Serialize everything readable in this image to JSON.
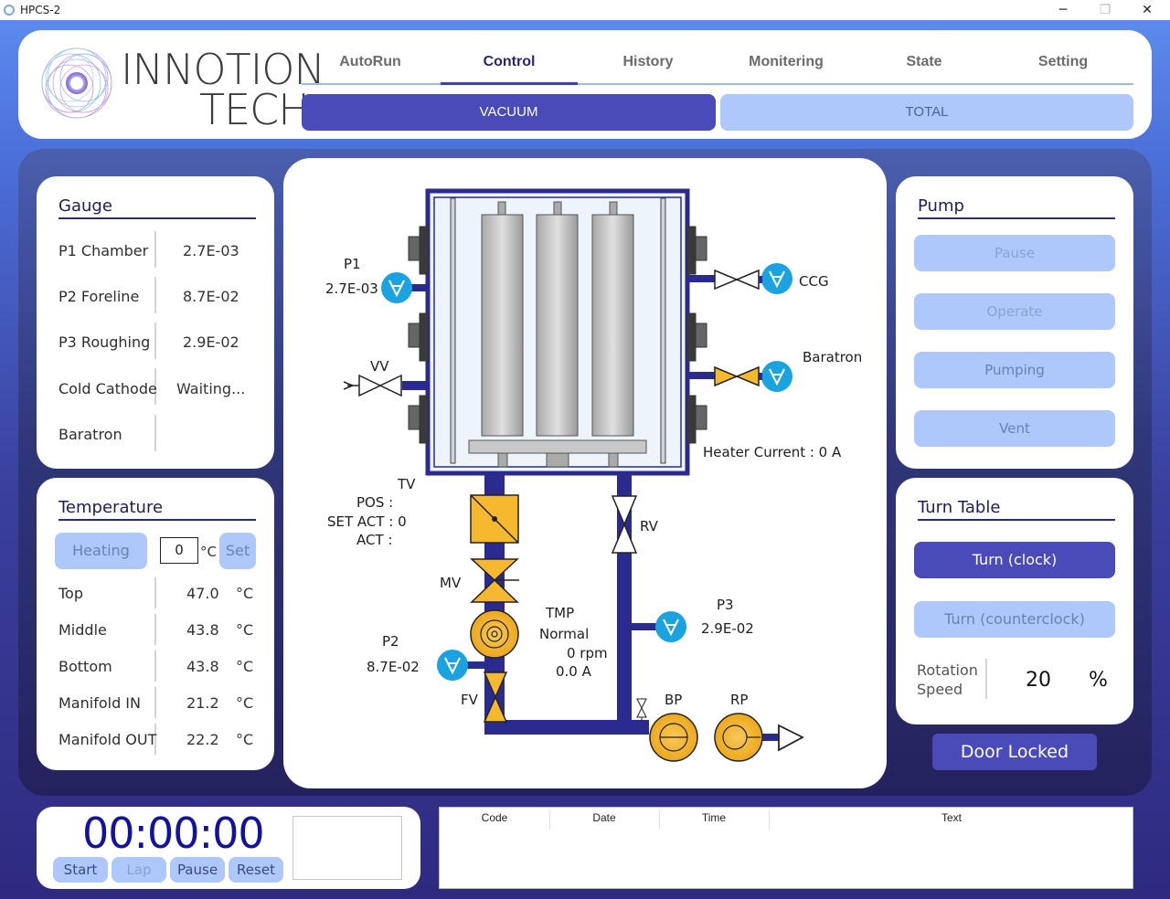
{
  "window": {
    "title": "HPCS-2",
    "minimize_glyph": "─",
    "maximize_glyph": "❐",
    "close_glyph": "✕"
  },
  "logo": {
    "line1": "INNOTION",
    "line2": "TECH"
  },
  "tabs": [
    {
      "label": "AutoRun"
    },
    {
      "label": "Control"
    },
    {
      "label": "History"
    },
    {
      "label": "Monitering"
    },
    {
      "label": "State"
    },
    {
      "label": "Setting"
    }
  ],
  "active_tab": "Control",
  "subtabs": {
    "vacuum": "VACUUM",
    "total": "TOTAL"
  },
  "gauge": {
    "title": "Gauge",
    "rows": [
      {
        "label": "P1 Chamber",
        "value": "2.7E-03"
      },
      {
        "label": "P2 Foreline",
        "value": "8.7E-02"
      },
      {
        "label": "P3 Roughing",
        "value": "2.9E-02"
      },
      {
        "label": "Cold Cathode",
        "value": "Waiting..."
      },
      {
        "label": "Baratron",
        "value": ""
      }
    ]
  },
  "temperature": {
    "title": "Temperature",
    "heating_label": "Heating",
    "setpoint_value": "0",
    "setpoint_unit": "°C",
    "set_label": "Set",
    "rows": [
      {
        "label": "Top",
        "value": "47.0",
        "unit": "°C"
      },
      {
        "label": "Middle",
        "value": "43.8",
        "unit": "°C"
      },
      {
        "label": "Bottom",
        "value": "43.8",
        "unit": "°C"
      },
      {
        "label": "Manifold IN",
        "value": "21.2",
        "unit": "°C"
      },
      {
        "label": "Manifold OUT",
        "value": "22.2",
        "unit": "°C"
      }
    ]
  },
  "diagram": {
    "p1_label": "P1",
    "p1_value": "2.7E-03",
    "ccg_label": "CCG",
    "vv_label": "VV",
    "baratron_label": "Baratron",
    "heater_current_text": "Heater Current :  0 A",
    "tv_label": "TV",
    "pos_text": "POS :",
    "set_act_text": "SET ACT : 0",
    "act_text": "ACT :",
    "rv_label": "RV",
    "mv_label": "MV",
    "tmp_label": "TMP",
    "tmp_status": "Normal",
    "tmp_rpm": "0 rpm",
    "tmp_current": "0.0 A",
    "p3_label": "P3",
    "p3_value": "2.9E-02",
    "p2_label": "P2",
    "p2_value": "8.7E-02",
    "fv_label": "FV",
    "bp_label": "BP",
    "rp_label": "RP",
    "colors": {
      "pipe": "#2b2b8f",
      "valve": "#f5b82e",
      "gauge": "#1aa3e0",
      "chamber_fill": "#eef4fb"
    }
  },
  "pump": {
    "title": "Pump",
    "buttons": [
      "Pause",
      "Operate",
      "Pumping",
      "Vent"
    ]
  },
  "turn_table": {
    "title": "Turn Table",
    "clock_label": "Turn (clock)",
    "counter_label": "Turn (counterclock)",
    "speed_label_1": "Rotation",
    "speed_label_2": "Speed",
    "speed_value": "20",
    "speed_unit": "%"
  },
  "door_status": "Door Locked",
  "timer": {
    "display": "00:00:00",
    "start": "Start",
    "lap": "Lap",
    "pause": "Pause",
    "reset": "Reset"
  },
  "log": {
    "columns": [
      "Code",
      "Date",
      "Time",
      "Text"
    ]
  }
}
